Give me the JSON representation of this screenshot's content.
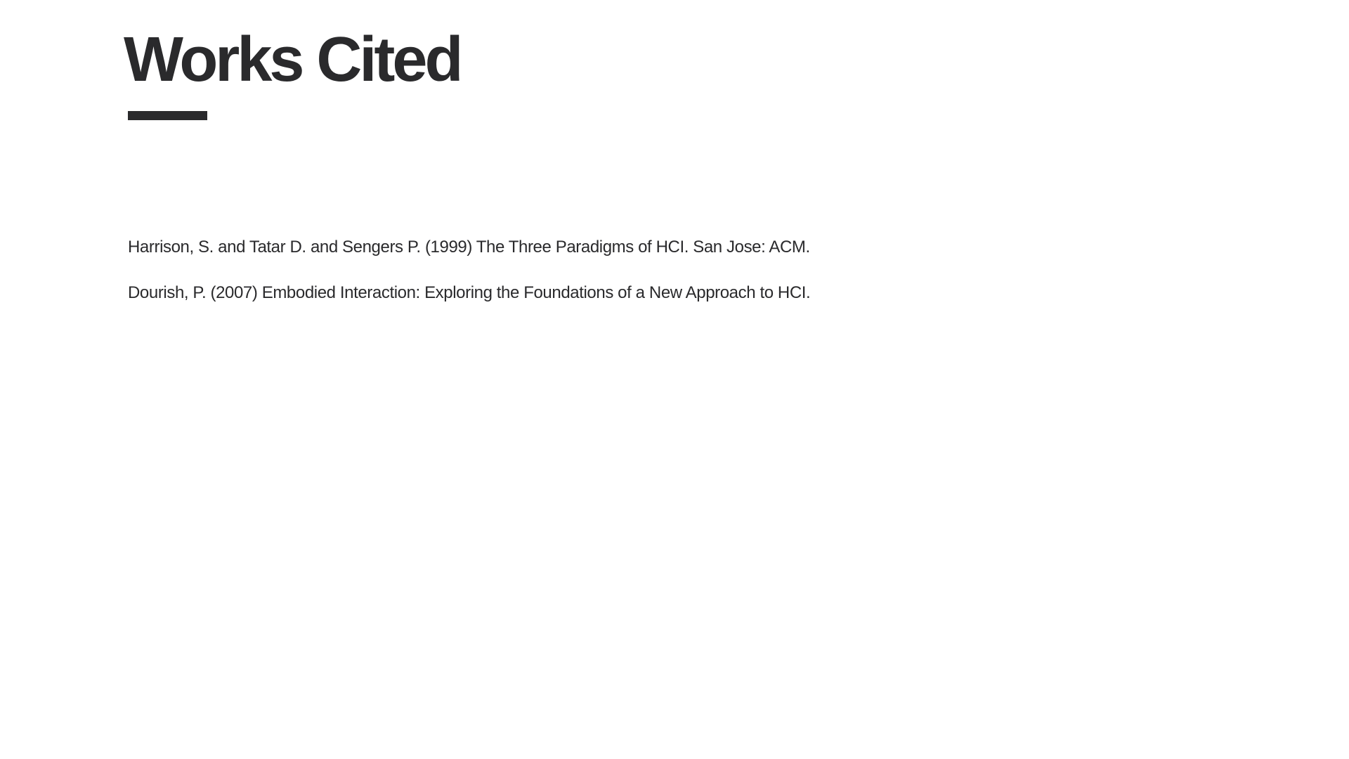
{
  "slide": {
    "title": "Works Cited",
    "citations": [
      "Harrison, S.  and Tatar D.  and Sengers P. (1999) The Three Paradigms of HCI.  San Jose: ACM.",
      "Dourish, P. (2007) Embodied Interaction: Exploring the Foundations of a New Approach to HCI."
    ]
  },
  "colors": {
    "text": "#2a2a2c",
    "background": "#ffffff"
  }
}
